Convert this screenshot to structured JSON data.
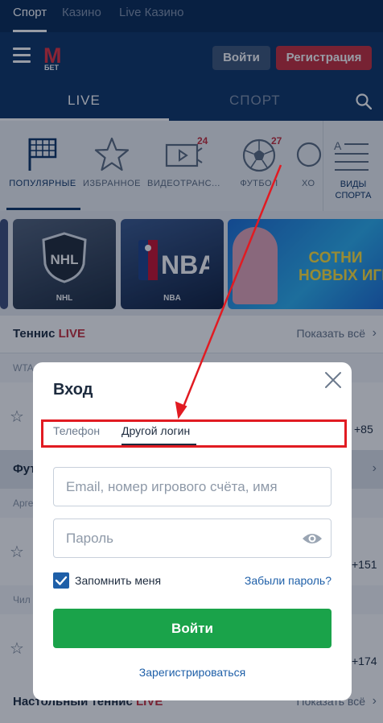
{
  "top_nav": {
    "tabs": [
      "Спорт",
      "Казино",
      "Live Казино"
    ]
  },
  "header": {
    "logo_letter": "M",
    "logo_sub": "БЕТ",
    "login_label": "Войти",
    "register_label": "Регистрация"
  },
  "sub_nav": {
    "live_label": "LIVE",
    "sport_label": "СПОРТ"
  },
  "categories": [
    {
      "label": "ПОПУЛЯРНЫЕ",
      "icon": "flag-icon",
      "badge": ""
    },
    {
      "label": "ИЗБРАННОЕ",
      "icon": "star-icon",
      "badge": ""
    },
    {
      "label": "ВИДЕОТРАНС...",
      "icon": "video-icon",
      "badge": "24"
    },
    {
      "label": "ФУТБОЛ",
      "icon": "soccer-ball-icon",
      "badge": "27"
    },
    {
      "label": "ХО",
      "icon": "hockey-icon",
      "badge": ""
    }
  ],
  "kinds_label_1": "ВИДЫ",
  "kinds_label_2": "СПОРТА",
  "kinds_icon_letter": "A",
  "banners": [
    {
      "label": "NHL",
      "title": "NHL"
    },
    {
      "label": "NBA",
      "title": "NBA"
    },
    {
      "line1": "СОТНИ",
      "line2": "НОВЫХ ИГР"
    }
  ],
  "list": {
    "tennis_title": "Теннис",
    "tennis_live": "LIVE",
    "show_all": "Показать всё",
    "wta_label": "WTA",
    "odds_1": "+85",
    "football_title": "Фут",
    "arg_label": "Арге",
    "odds_2": "+151",
    "chile_label": "Чил",
    "odds_3": "+174",
    "table_tennis_title": "Настольный теннис",
    "table_tennis_live": "LIVE"
  },
  "modal": {
    "title": "Вход",
    "tab_phone": "Телефон",
    "tab_other": "Другой логин",
    "login_placeholder": "Email, номер игрового счёта, имя",
    "password_placeholder": "Пароль",
    "remember_label": "Запомнить меня",
    "forgot_label": "Забыли пароль?",
    "submit_label": "Войти",
    "register_link": "Зарегистрироваться"
  },
  "colors": {
    "header_bg": "#0d3466",
    "brand_red": "#c62e3b",
    "submit_green": "#1aa34a",
    "link_blue": "#1e5fa8",
    "annotation_red": "#e11b22"
  }
}
